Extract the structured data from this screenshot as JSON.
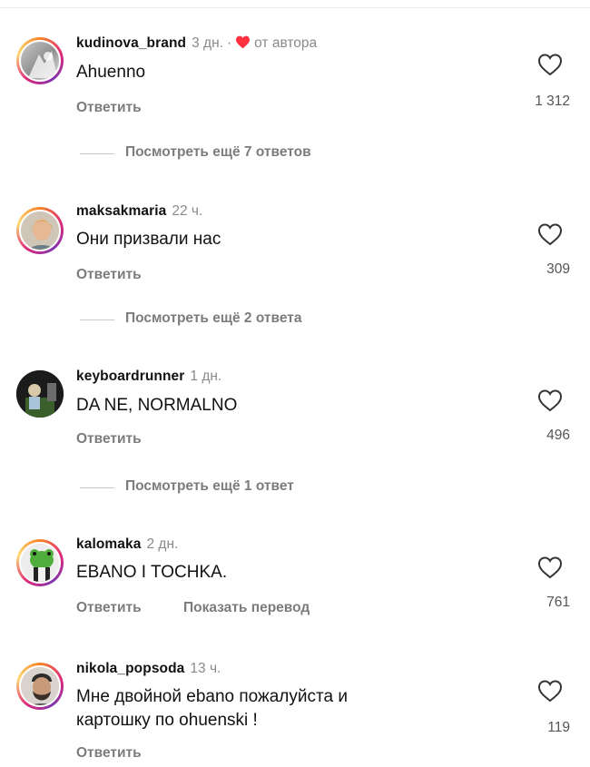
{
  "comments": [
    {
      "username": "kudinova_brand",
      "time": "3 дн.",
      "separator": "·",
      "author_label": "от автора",
      "text": "Ahuenno",
      "reply_label": "Ответить",
      "likes": "1 312",
      "more_replies": "Посмотреть ещё 7 ответов"
    },
    {
      "username": "maksakmaria",
      "time": "22 ч.",
      "text": "Они призвали нас",
      "reply_label": "Ответить",
      "likes": "309",
      "more_replies": "Посмотреть ещё 2 ответа"
    },
    {
      "username": "keyboardrunner",
      "time": "1 дн.",
      "text": "DA NE, NORMALNO",
      "reply_label": "Ответить",
      "likes": "496",
      "more_replies": "Посмотреть ещё 1 ответ"
    },
    {
      "username": "kalomaka",
      "time": "2 дн.",
      "text": "EBANO I TOCHKA.",
      "reply_label": "Ответить",
      "translate_label": "Показать перевод",
      "likes": "761"
    },
    {
      "username": "nikola_popsoda",
      "time": "13 ч.",
      "text_line1": "Мне двойной ebano пожалуйста и",
      "text_line2": "картошку по ohuenski !",
      "reply_label": "Ответить",
      "likes": "119"
    }
  ],
  "colors": {
    "heart_red": "#ff3040",
    "muted_text": "#7c7c7c",
    "story_ring": "#dd2a7b"
  },
  "icons": [
    "heart-outline-icon",
    "heart-filled-icon"
  ]
}
